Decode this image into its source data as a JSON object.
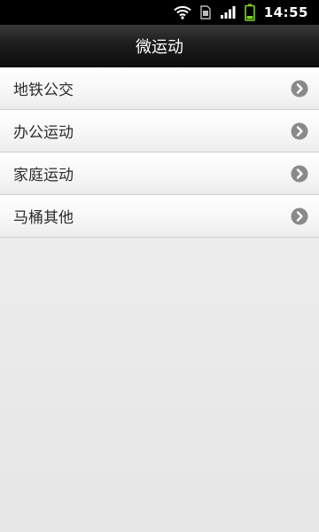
{
  "status_bar": {
    "time": "14:55",
    "icons": [
      "wifi-icon",
      "sim-card-icon",
      "signal-strength-icon",
      "battery-icon"
    ],
    "battery_color": "#7ed321"
  },
  "header": {
    "title": "微运动"
  },
  "menu": {
    "items": [
      {
        "label": "地铁公交",
        "icon": "chevron-right-icon"
      },
      {
        "label": "办公运动",
        "icon": "chevron-right-icon"
      },
      {
        "label": "家庭运动",
        "icon": "chevron-right-icon"
      },
      {
        "label": "马桶其他",
        "icon": "chevron-right-icon"
      }
    ]
  },
  "colors": {
    "title_bar": "#1d1d1d",
    "chevron": "#8a8a8a",
    "background": "#ececec"
  }
}
